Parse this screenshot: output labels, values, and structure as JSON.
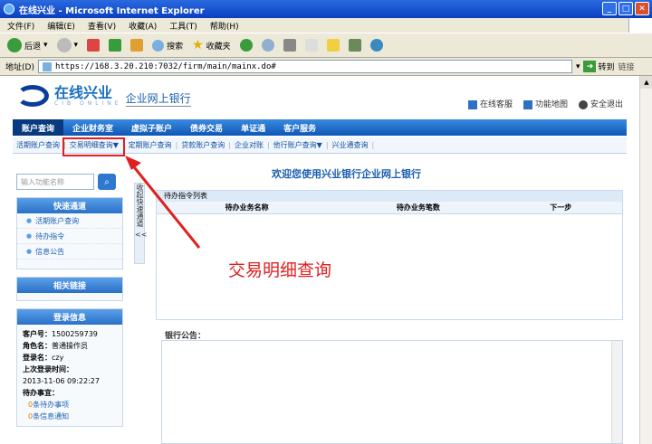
{
  "window": {
    "title": "在线兴业 - Microsoft Internet Explorer"
  },
  "menu": [
    "文件(F)",
    "编辑(E)",
    "查看(V)",
    "收藏(A)",
    "工具(T)",
    "帮助(H)"
  ],
  "toolbar": {
    "back": "后退",
    "search": "搜索",
    "favorites": "收藏夹"
  },
  "address": {
    "label": "地址(D)",
    "url": "https://168.3.20.210:7032/firm/main/mainx.do#",
    "go": "转到",
    "links": "链接"
  },
  "header": {
    "logo_name": "在线兴业",
    "logo_sub": "CIB ONLINE",
    "bank_label": "企业网上银行",
    "links": [
      "在线客服",
      "功能地图",
      "安全退出"
    ]
  },
  "nav": [
    "账户查询",
    "企业财务室",
    "虚拟子账户",
    "债券交易",
    "单证通",
    "客户服务"
  ],
  "subnav": [
    "活期账户查询",
    "交易明细查询▼",
    "定期账户查询",
    "贷款账户查询",
    "企业对账",
    "他行账户查询▼",
    "兴业通查询"
  ],
  "sidebar": {
    "search_placeholder": "输入功能名称",
    "quick_title": "快速通道",
    "quick_items": [
      "活期账户查询",
      "待办指令",
      "信息公告"
    ],
    "related_title": "相关链接",
    "login_title": "登录信息",
    "customer_label": "客户号：",
    "customer": "1500259739",
    "role_label": "角色名：",
    "role": "普通操作员",
    "user_label": "登录名：",
    "user": "czy",
    "last_login_label": "上次登录时间：",
    "last_login": "2013-11-06 09:22:27",
    "todo_label": "待办事宜：",
    "todo_count": "0",
    "todo_text": "条待办事项",
    "msg_count": "0",
    "msg_text": "条信息通知"
  },
  "collapse": {
    "label": "收起快速通道",
    "arrow": "<<"
  },
  "main": {
    "welcome": "欢迎您使用兴业银行企业网上银行",
    "task_title": "待办指令列表",
    "task_cols": [
      "待办业务名称",
      "待办业务笔数",
      "下一步"
    ],
    "notice_title": "银行公告："
  },
  "annotation": {
    "text": "交易明细查询",
    "color": "#e02020"
  }
}
